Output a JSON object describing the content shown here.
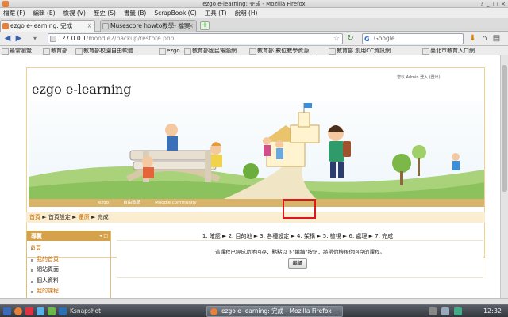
{
  "window": {
    "title": "ezgo e-learning: 完成 - Mozilla Firefox",
    "buttons": [
      "?",
      "_",
      "□",
      "×"
    ]
  },
  "menu": [
    "檔案 (F)",
    "編輯 (E)",
    "檢視 (V)",
    "歷史 (S)",
    "書籤 (B)",
    "ScrapBook (C)",
    "工具 (T)",
    "說明 (H)"
  ],
  "tabs": [
    {
      "label": "ezgo e-learning: 完成",
      "active": true
    },
    {
      "label": "Musescore howto教學- 檔案",
      "active": false
    }
  ],
  "newtab": "+",
  "nav": {
    "back": "◀",
    "forward": "▶",
    "url_host": "127.0.0.1",
    "url_path": "/moodle2/backup/restore.php",
    "search_placeholder": "Google"
  },
  "bookmarks": [
    "最常瀏覽",
    "教育部",
    "教育部校園自由軟體...",
    "ezgo",
    "教育部國民電腦網",
    "教育部 數位教學資源...",
    "教育部 創用CC資訊網",
    "臺北市教育入口網"
  ],
  "page": {
    "brand": "ezgo e-learning",
    "login_status": "您以 Admin 登入 (登出)",
    "site_nav": [
      "ezgo",
      "自由軟體",
      "Moodle community"
    ],
    "breadcrumb": {
      "home": "首頁",
      "sep": "►",
      "settings": "首頁設定",
      "restore": "還原",
      "done": "完成"
    },
    "sidebar": {
      "header": "導覽",
      "controls": "◂ □",
      "items": [
        "首頁",
        "我的首頁",
        "網站頁面",
        "個人資料",
        "我的課程"
      ]
    },
    "steps": "1. 確認 ► 2. 目的地 ► 3. 各種設定 ► 4. 架構 ► 5. 檢視 ► 6. 處理 ► 7. 完成",
    "message": "這課程已經成功地回存，點點以下\"繼續\"按鈕，將帶你檢視你回存的課程。",
    "continue_label": "繼續"
  },
  "taskbar": {
    "ksnapshot": "Ksnapshot",
    "firefox": "ezgo e-learning: 完成 - Mozilla Firefox",
    "clock": "12:32"
  }
}
